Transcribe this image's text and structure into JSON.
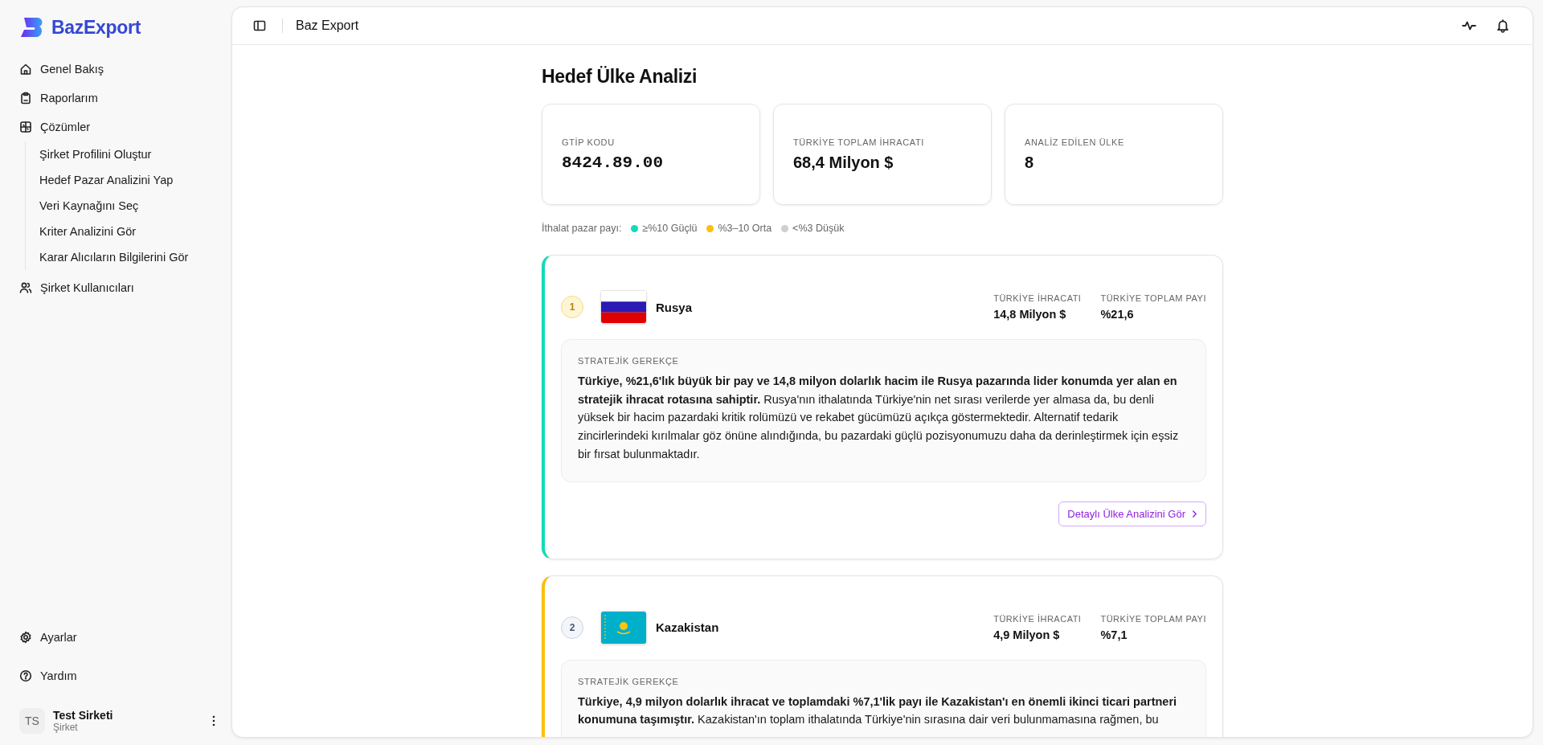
{
  "sidebar": {
    "logo": "BazExport",
    "nav": [
      {
        "label": "Genel Bakış",
        "kind": "home"
      },
      {
        "label": "Raporlarım",
        "kind": "clipboard"
      },
      {
        "label": "Çözümler",
        "kind": "grid",
        "children": [
          {
            "label": "Şirket Profilini Oluştur"
          },
          {
            "label": "Hedef Pazar Analizini Yap"
          },
          {
            "label": "Veri Kaynağını Seç"
          },
          {
            "label": "Kriter Analizini Gör"
          },
          {
            "label": "Karar Alıcıların Bilgilerini Gör"
          }
        ]
      },
      {
        "label": "Şirket Kullanıcıları",
        "kind": "users"
      }
    ],
    "footer_nav": [
      {
        "label": "Ayarlar",
        "kind": "gear"
      },
      {
        "label": "Yardım",
        "kind": "help"
      }
    ],
    "user": {
      "initials": "TS",
      "name": "Test Sirketi",
      "role": "Şirket"
    }
  },
  "header": {
    "title": "Baz Export"
  },
  "page": {
    "title": "Hedef Ülke Analizi",
    "stats": [
      {
        "label": "GTİP KODU",
        "value": "8424.89.00",
        "kind": "code"
      },
      {
        "label": "TÜRKİYE TOPLAM İHRACATI",
        "value": "68,4 Milyon $",
        "kind": "text"
      },
      {
        "label": "ANALİZ EDİLEN ÜLKE",
        "value": "8",
        "kind": "text"
      }
    ],
    "legend": {
      "label": "İthalat pazar payı:",
      "items": [
        {
          "label": "≥%10 Güçlü",
          "color": "#13dbb6"
        },
        {
          "label": "%3–10 Orta",
          "color": "#fbbf0f"
        },
        {
          "label": "<%3 Düşük",
          "color": "#cfcfcf"
        }
      ]
    },
    "countries": [
      {
        "rank": {
          "label": "1",
          "kind": "gold"
        },
        "flag": {
          "kind": "ru"
        },
        "name": "Rusya",
        "color": "#13dbb6",
        "stats": [
          {
            "label": "TÜRKİYE İHRACATI",
            "value": "14,8 Milyon $"
          },
          {
            "label": "TÜRKİYE TOPLAM PAYI",
            "value": "%21,6"
          }
        ],
        "rationale_label": "STRATEJİK GEREKÇE",
        "rationale": "**Türkiye, %21,6'lık büyük bir pay ve 14,8 milyon dolarlık hacim ile Rusya pazarında lider konumda yer alan en stratejik ihracat rotasına sahiptir.** Rusya'nın ithalatında Türkiye'nin net sırası verilerde yer almasa da, bu denli yüksek bir hacim pazardaki kritik rolümüzü ve rekabet gücümüzü açıkça göstermektedir. Alternatif tedarik zincirlerindeki kırılmalar göz önüne alındığında, bu pazardaki güçlü pozisyonumuzu daha da derinleştirmek için eşsiz bir fırsat bulunmaktadır.",
        "button": "Detaylı Ülke Analizini Gör"
      },
      {
        "rank": {
          "label": "2",
          "kind": "silver"
        },
        "flag": {
          "kind": "kz"
        },
        "name": "Kazakistan",
        "color": "#fbbf0f",
        "stats": [
          {
            "label": "TÜRKİYE İHRACATI",
            "value": "4,9 Milyon $"
          },
          {
            "label": "TÜRKİYE TOPLAM PAYI",
            "value": "%7,1"
          }
        ],
        "rationale_label": "STRATEJİK GEREKÇE",
        "rationale": "**Türkiye, 4,9 milyon dolarlık ihracat ve toplamdaki %7,1'lik payı ile Kazakistan'ı en önemli ikinci ticari partneri konumuna taşımıştır.** Kazakistan'ın toplam ithalatında Türkiye'nin sırasına dair veri bulunmamasına rağmen, bu"
      }
    ]
  }
}
